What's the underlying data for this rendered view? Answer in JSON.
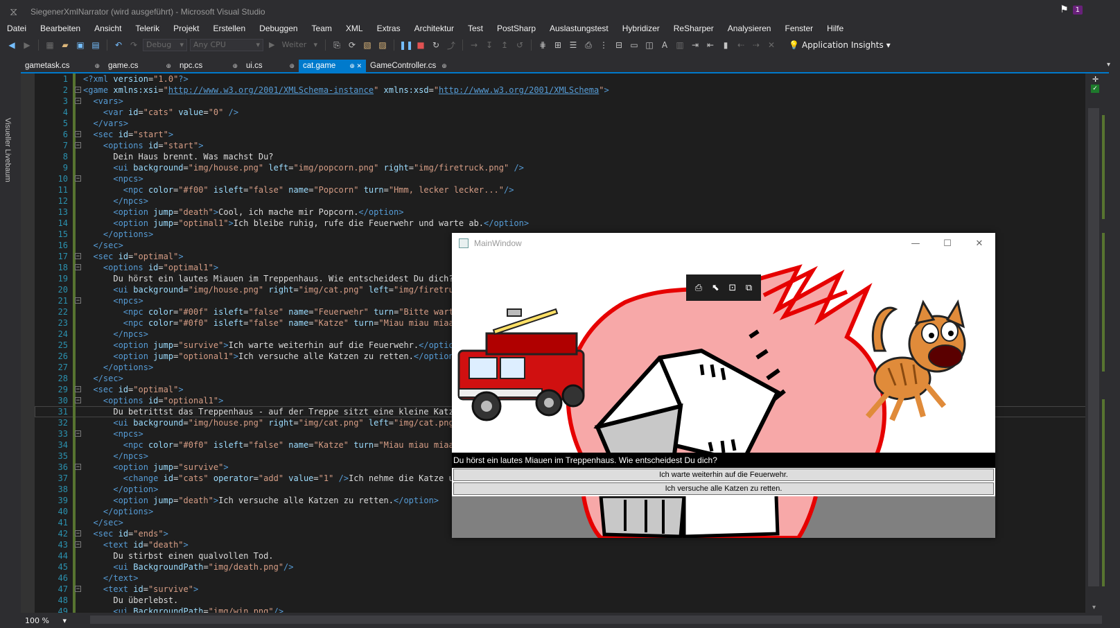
{
  "window": {
    "title": "SiegenerXmlNarrator (wird ausgeführt) - Microsoft Visual Studio",
    "notification_count": "1"
  },
  "menu": [
    "Datei",
    "Bearbeiten",
    "Ansicht",
    "Telerik",
    "Projekt",
    "Erstellen",
    "Debuggen",
    "Team",
    "XML",
    "Extras",
    "Architektur",
    "Test",
    "PostSharp",
    "Auslastungstest",
    "Hybridizer",
    "ReSharper",
    "Analysieren",
    "Fenster",
    "Hilfe"
  ],
  "toolbar": {
    "config": "Debug",
    "platform": "Any CPU",
    "continue_label": "Weiter",
    "app_insights": "Application Insights"
  },
  "tabs": [
    {
      "label": "gametask.cs",
      "active": false
    },
    {
      "label": "game.cs",
      "active": false
    },
    {
      "label": "npc.cs",
      "active": false
    },
    {
      "label": "ui.cs",
      "active": false
    },
    {
      "label": "cat.game",
      "active": true
    },
    {
      "label": "GameController.cs",
      "active": false
    }
  ],
  "side_panel_label": "Visueller Livebaum",
  "editor": {
    "zoom": "100 %",
    "current_line": 31,
    "lines": [
      {
        "n": 1,
        "t": "<?xml version=\"1.0\"?>"
      },
      {
        "n": 2,
        "t": "<game xmlns:xsi=\"http://www.w3.org/2001/XMLSchema-instance\" xmlns:xsd=\"http://www.w3.org/2001/XMLSchema\">"
      },
      {
        "n": 3,
        "t": "  <vars>"
      },
      {
        "n": 4,
        "t": "    <var id=\"cats\" value=\"0\" />"
      },
      {
        "n": 5,
        "t": "  </vars>"
      },
      {
        "n": 6,
        "t": "  <sec id=\"start\">"
      },
      {
        "n": 7,
        "t": "    <options id=\"start\">"
      },
      {
        "n": 8,
        "t": "      Dein Haus brennt. Was machst Du?"
      },
      {
        "n": 9,
        "t": "      <ui background=\"img/house.png\" left=\"img/popcorn.png\" right=\"img/firetruck.png\" />"
      },
      {
        "n": 10,
        "t": "      <npcs>"
      },
      {
        "n": 11,
        "t": "        <npc color=\"#f00\" isleft=\"false\" name=\"Popcorn\" turn=\"Hmm, lecker lecker...\"/>"
      },
      {
        "n": 12,
        "t": "      </npcs>"
      },
      {
        "n": 13,
        "t": "      <option jump=\"death\">Cool, ich mache mir Popcorn.</option>"
      },
      {
        "n": 14,
        "t": "      <option jump=\"optimal1\">Ich bleibe ruhig, rufe die Feuerwehr und warte ab.</option>"
      },
      {
        "n": 15,
        "t": "    </options>"
      },
      {
        "n": 16,
        "t": "  </sec>"
      },
      {
        "n": 17,
        "t": "  <sec id=\"optimal\">"
      },
      {
        "n": 18,
        "t": "    <options id=\"optimal1\">"
      },
      {
        "n": 19,
        "t": "      Du hörst ein lautes Miauen im Treppenhaus. Wie entscheidest Du dich?"
      },
      {
        "n": 20,
        "t": "      <ui background=\"img/house.png\" right=\"img/cat.png\" left=\"img/firetruck"
      },
      {
        "n": 21,
        "t": "      <npcs>"
      },
      {
        "n": 22,
        "t": "        <npc color=\"#00f\" isleft=\"false\" name=\"Feuerwehr\" turn=\"Bitte warten"
      },
      {
        "n": 23,
        "t": "        <npc color=\"#0f0\" isleft=\"false\" name=\"Katze\" turn=\"Miau miau miaau"
      },
      {
        "n": 24,
        "t": "      </npcs>"
      },
      {
        "n": 25,
        "t": "      <option jump=\"survive\">Ich warte weiterhin auf die Feuerwehr.</option>"
      },
      {
        "n": 26,
        "t": "      <option jump=\"optional1\">Ich versuche alle Katzen zu retten.</option>"
      },
      {
        "n": 27,
        "t": "    </options>"
      },
      {
        "n": 28,
        "t": "  </sec>"
      },
      {
        "n": 29,
        "t": "  <sec id=\"optimal\">"
      },
      {
        "n": 30,
        "t": "    <options id=\"optional1\">"
      },
      {
        "n": 31,
        "t": "      Du betrittst das Treppenhaus - auf der Treppe sitzt eine kleine Katze."
      },
      {
        "n": 32,
        "t": "      <ui background=\"img/house.png\" right=\"img/cat.png\" left=\"img/cat.png\""
      },
      {
        "n": 33,
        "t": "      <npcs>"
      },
      {
        "n": 34,
        "t": "        <npc color=\"#0f0\" isleft=\"false\" name=\"Katze\" turn=\"Miau miau miaaau"
      },
      {
        "n": 35,
        "t": "      </npcs>"
      },
      {
        "n": 36,
        "t": "      <option jump=\"survive\">"
      },
      {
        "n": 37,
        "t": "        <change id=\"cats\" operator=\"add\" value=\"1\" />Ich nehme die Katze und"
      },
      {
        "n": 38,
        "t": "      </option>"
      },
      {
        "n": 39,
        "t": "      <option jump=\"death\">Ich versuche alle Katzen zu retten.</option>"
      },
      {
        "n": 40,
        "t": "    </options>"
      },
      {
        "n": 41,
        "t": "  </sec>"
      },
      {
        "n": 42,
        "t": "  <sec id=\"ends\">"
      },
      {
        "n": 43,
        "t": "    <text id=\"death\">"
      },
      {
        "n": 44,
        "t": "      Du stirbst einen qualvollen Tod."
      },
      {
        "n": 45,
        "t": "      <ui BackgroundPath=\"img/death.png\"/>"
      },
      {
        "n": 46,
        "t": "    </text>"
      },
      {
        "n": 47,
        "t": "    <text id=\"survive\">"
      },
      {
        "n": 48,
        "t": "      Du überlebst."
      },
      {
        "n": 49,
        "t": "      <ui BackgroundPath=\"img/win.png\"/>"
      }
    ]
  },
  "main_window": {
    "title": "MainWindow",
    "question": "Du hörst ein lautes Miauen im Treppenhaus. Wie entscheidest Du dich?",
    "options": [
      "Ich warte weiterhin auf die Feuerwehr.",
      "Ich versuche alle Katzen zu retten."
    ]
  },
  "colors": {
    "accent": "#007acc",
    "tag": "#569cd6",
    "attr_name": "#9cdcfe",
    "attr_value": "#d69d85",
    "text": "#dcdcdc",
    "line_number": "#2b91af",
    "change_marker": "#577430",
    "flame_red": "#e60000",
    "flame_pink": "#f7a8a8"
  }
}
